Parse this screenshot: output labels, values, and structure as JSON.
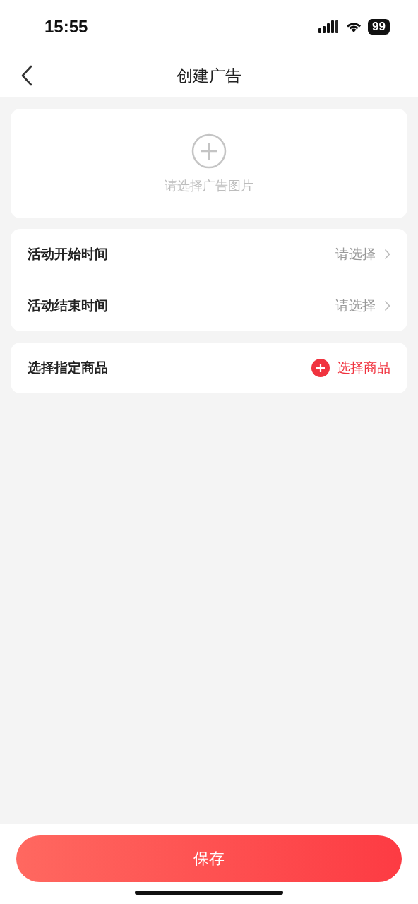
{
  "status_bar": {
    "time": "15:55",
    "battery": "99"
  },
  "nav": {
    "title": "创建广告"
  },
  "image_picker": {
    "label": "请选择广告图片"
  },
  "time_rows": [
    {
      "label": "活动开始时间",
      "value": "请选择"
    },
    {
      "label": "活动结束时间",
      "value": "请选择"
    }
  ],
  "product_row": {
    "label": "选择指定商品",
    "action": "选择商品"
  },
  "save_button": "保存"
}
